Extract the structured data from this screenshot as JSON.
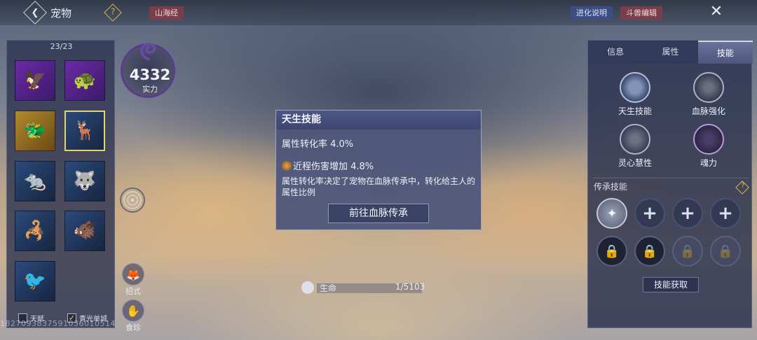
{
  "header": {
    "back_icon": "back-arrow-icon",
    "title": "宠物",
    "help": "?",
    "tag_shanhai": "山海经",
    "evolution_btn": "进化说明",
    "beast_edit_btn": "斗兽编辑",
    "close": "✕"
  },
  "pet_list": {
    "count": "23/23",
    "pets": [
      {
        "icon": "eagle-pet-icon",
        "glyph": "🦅",
        "bg": "purple"
      },
      {
        "icon": "turtle-pet-icon",
        "glyph": "🐢",
        "bg": "purple"
      },
      {
        "icon": "dragon-pet-icon",
        "glyph": "🐲",
        "bg": "gold"
      },
      {
        "icon": "deer-pet-icon",
        "glyph": "🦌",
        "bg": "blue",
        "selected": true
      },
      {
        "icon": "rat-pet-icon",
        "glyph": "🐀",
        "bg": "blue"
      },
      {
        "icon": "wolf-pet-icon",
        "glyph": "🐺",
        "bg": "blue"
      },
      {
        "icon": "scorpion-pet-icon",
        "glyph": "🦂",
        "bg": "blue"
      },
      {
        "icon": "beast-pet-icon",
        "glyph": "🐗",
        "bg": "blue"
      },
      {
        "icon": "griffin-pet-icon",
        "glyph": "🐦",
        "bg": "blue"
      }
    ],
    "checkbox_1": {
      "label": "天赋",
      "checked": false
    },
    "checkbox_2": {
      "label": "青光单城",
      "checked": true
    },
    "watermark": "1827093837591036010514"
  },
  "power": {
    "value": "4332",
    "label": "实力"
  },
  "side_buttons": {
    "moves": "招式",
    "treasure": "食珍"
  },
  "hp": {
    "label": "生命",
    "value": "1/5103"
  },
  "popup": {
    "title": "天生技能",
    "rate_line": "属性转化率 4.0%",
    "bonus_line": "近程伤害增加 4.8%",
    "description": "属性转化率决定了宠物在血脉传承中，转化给主人的属性比例",
    "action_button": "前往血脉传承"
  },
  "right_panel": {
    "tabs": [
      "信息",
      "属性",
      "技能"
    ],
    "active_tab": "技能",
    "skills": [
      {
        "label": "天生技能",
        "icon": "innate-skill-icon"
      },
      {
        "label": "血脉强化",
        "icon": "bloodline-icon"
      },
      {
        "label": "灵心慧性",
        "icon": "spirit-icon"
      },
      {
        "label": "魂力",
        "icon": "soul-icon"
      }
    ],
    "inherit_title": "传承技能",
    "inherit_help": "?",
    "get_skill_btn": "技能获取"
  }
}
